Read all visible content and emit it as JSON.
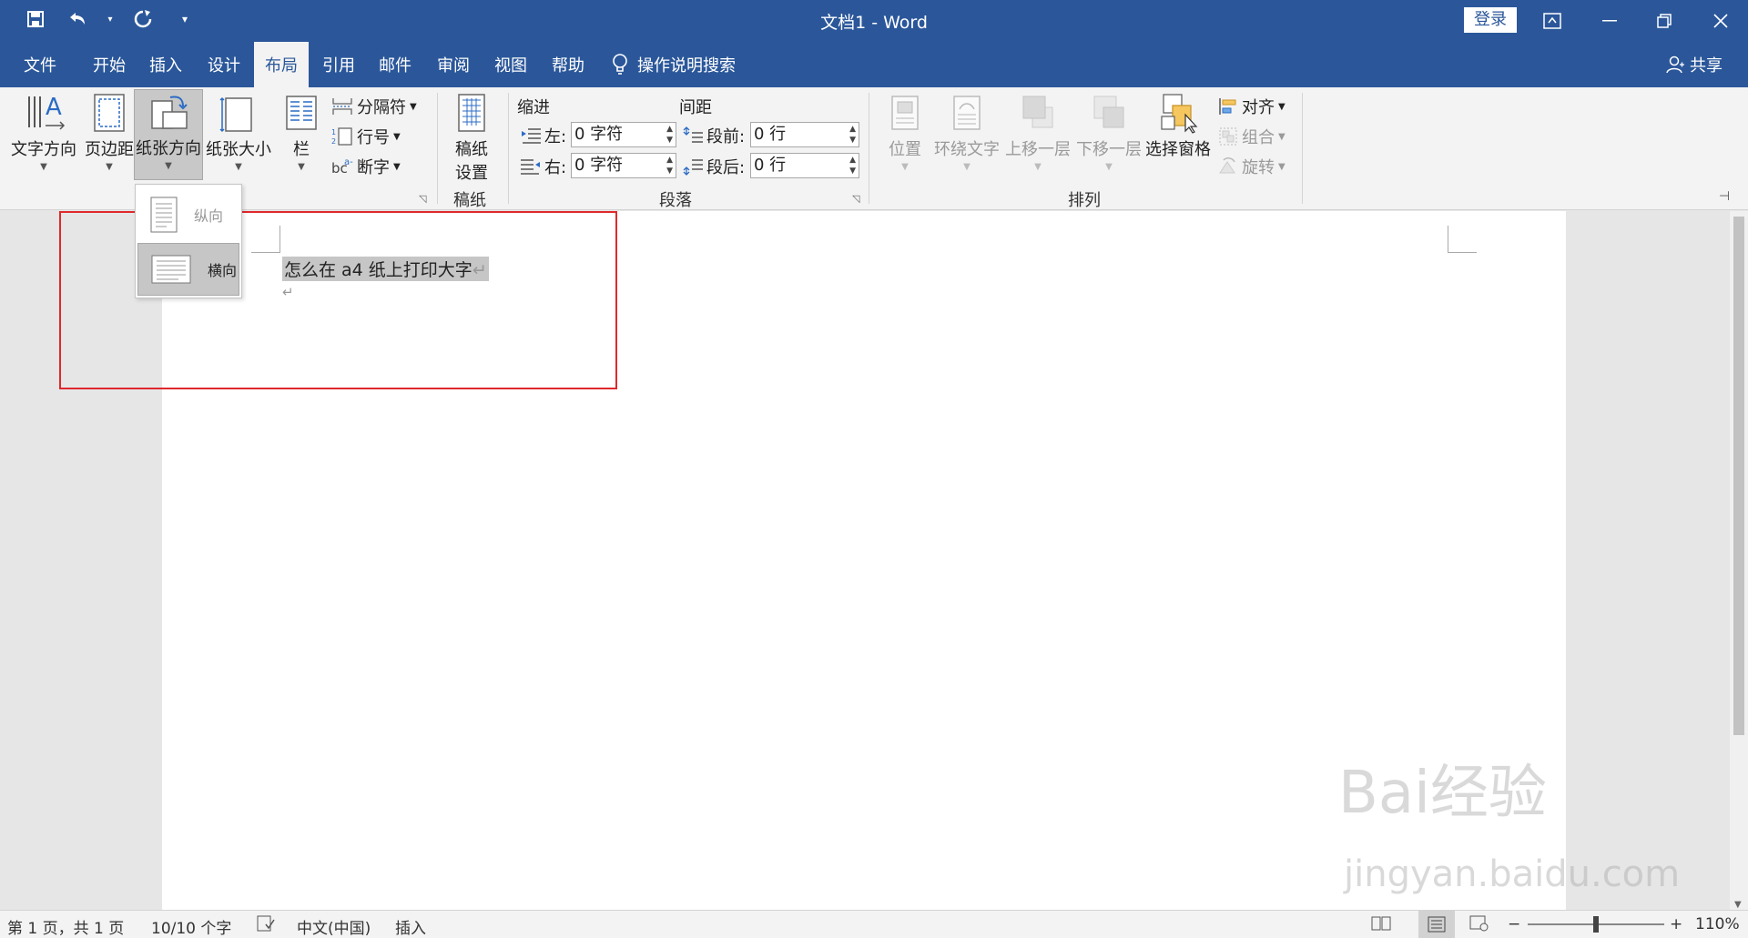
{
  "window": {
    "title": "文档1  -  Word",
    "login_label": "登录"
  },
  "tabs": [
    {
      "label": "文件"
    },
    {
      "label": "开始"
    },
    {
      "label": "插入"
    },
    {
      "label": "设计"
    },
    {
      "label": "布局"
    },
    {
      "label": "引用"
    },
    {
      "label": "邮件"
    },
    {
      "label": "审阅"
    },
    {
      "label": "视图"
    },
    {
      "label": "帮助"
    }
  ],
  "tell_me": "操作说明搜索",
  "share_label": "共享",
  "ribbon": {
    "page_setup": {
      "text_direction": "文字方向",
      "margins": "页边距",
      "orientation": "纸张方向",
      "size": "纸张大小",
      "columns": "栏",
      "breaks": "分隔符",
      "line_numbers": "行号",
      "hyphenation": "断字"
    },
    "manuscript": {
      "settings_line1": "稿纸",
      "settings_line2": "设置",
      "group_label": "稿纸"
    },
    "paragraph": {
      "indent_label": "缩进",
      "spacing_label": "间距",
      "left_label": "左:",
      "right_label": "右:",
      "before_label": "段前:",
      "after_label": "段后:",
      "left_value": "0 字符",
      "right_value": "0 字符",
      "before_value": "0 行",
      "after_value": "0 行",
      "group_label": "段落"
    },
    "arrange": {
      "position": "位置",
      "wrap_text": "环绕文字",
      "bring_forward": "上移一层",
      "send_backward": "下移一层",
      "selection_pane": "选择窗格",
      "align": "对齐",
      "group": "组合",
      "rotate": "旋转",
      "group_label": "排列"
    }
  },
  "orientation_menu": {
    "portrait": "纵向",
    "landscape": "横向"
  },
  "document": {
    "text": "怎么在 a4 纸上打印大字",
    "para_mark": "↵"
  },
  "statusbar": {
    "page": "第 1 页，共 1 页",
    "words": "10/10 个字",
    "language": "中文(中国)",
    "mode": "插入",
    "zoom": "110%"
  },
  "watermark": {
    "brand": "Bai经验",
    "url": "jingyan.baidu.com"
  }
}
